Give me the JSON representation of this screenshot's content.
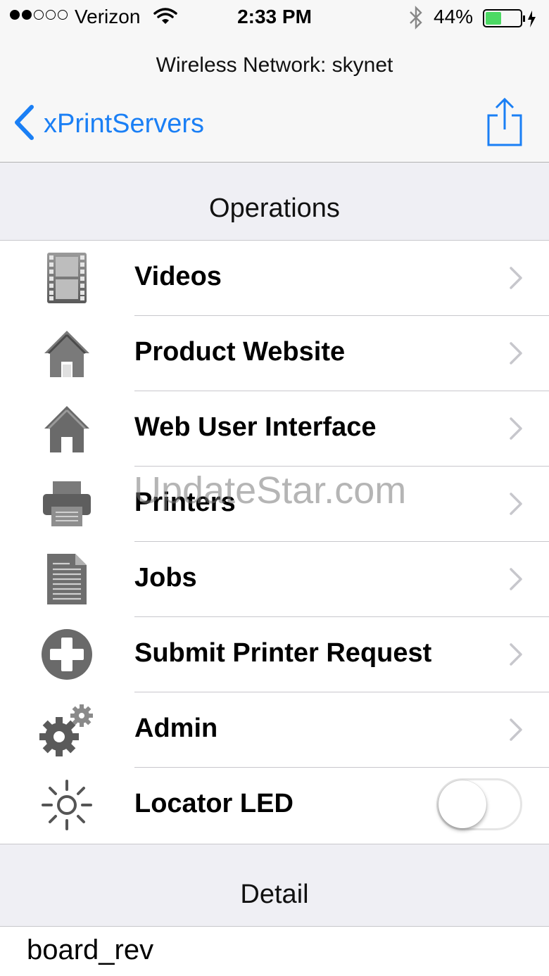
{
  "status_bar": {
    "carrier": "Verizon",
    "time": "2:33 PM",
    "battery": "44%",
    "battery_level": 0.44,
    "signal_bars": 2,
    "signal_max": 5
  },
  "nav": {
    "subtitle": "Wireless Network: skynet",
    "back_label": "xPrintServers",
    "accent": "#1a7ff5"
  },
  "sections": {
    "operations": "Operations",
    "detail": "Detail"
  },
  "rows": [
    {
      "label": "Videos",
      "icon": "film-icon"
    },
    {
      "label": "Product Website",
      "icon": "house-icon"
    },
    {
      "label": "Web User Interface",
      "icon": "house-icon"
    },
    {
      "label": "Printers",
      "icon": "printer-icon"
    },
    {
      "label": "Jobs",
      "icon": "document-icon"
    },
    {
      "label": "Submit Printer Request",
      "icon": "plus-circle-icon"
    },
    {
      "label": "Admin",
      "icon": "gears-icon"
    },
    {
      "label": "Locator LED",
      "icon": "light-icon",
      "toggle_on": false
    }
  ],
  "detail": {
    "first_item": "board_rev"
  },
  "watermark": "UpdateStar.com"
}
